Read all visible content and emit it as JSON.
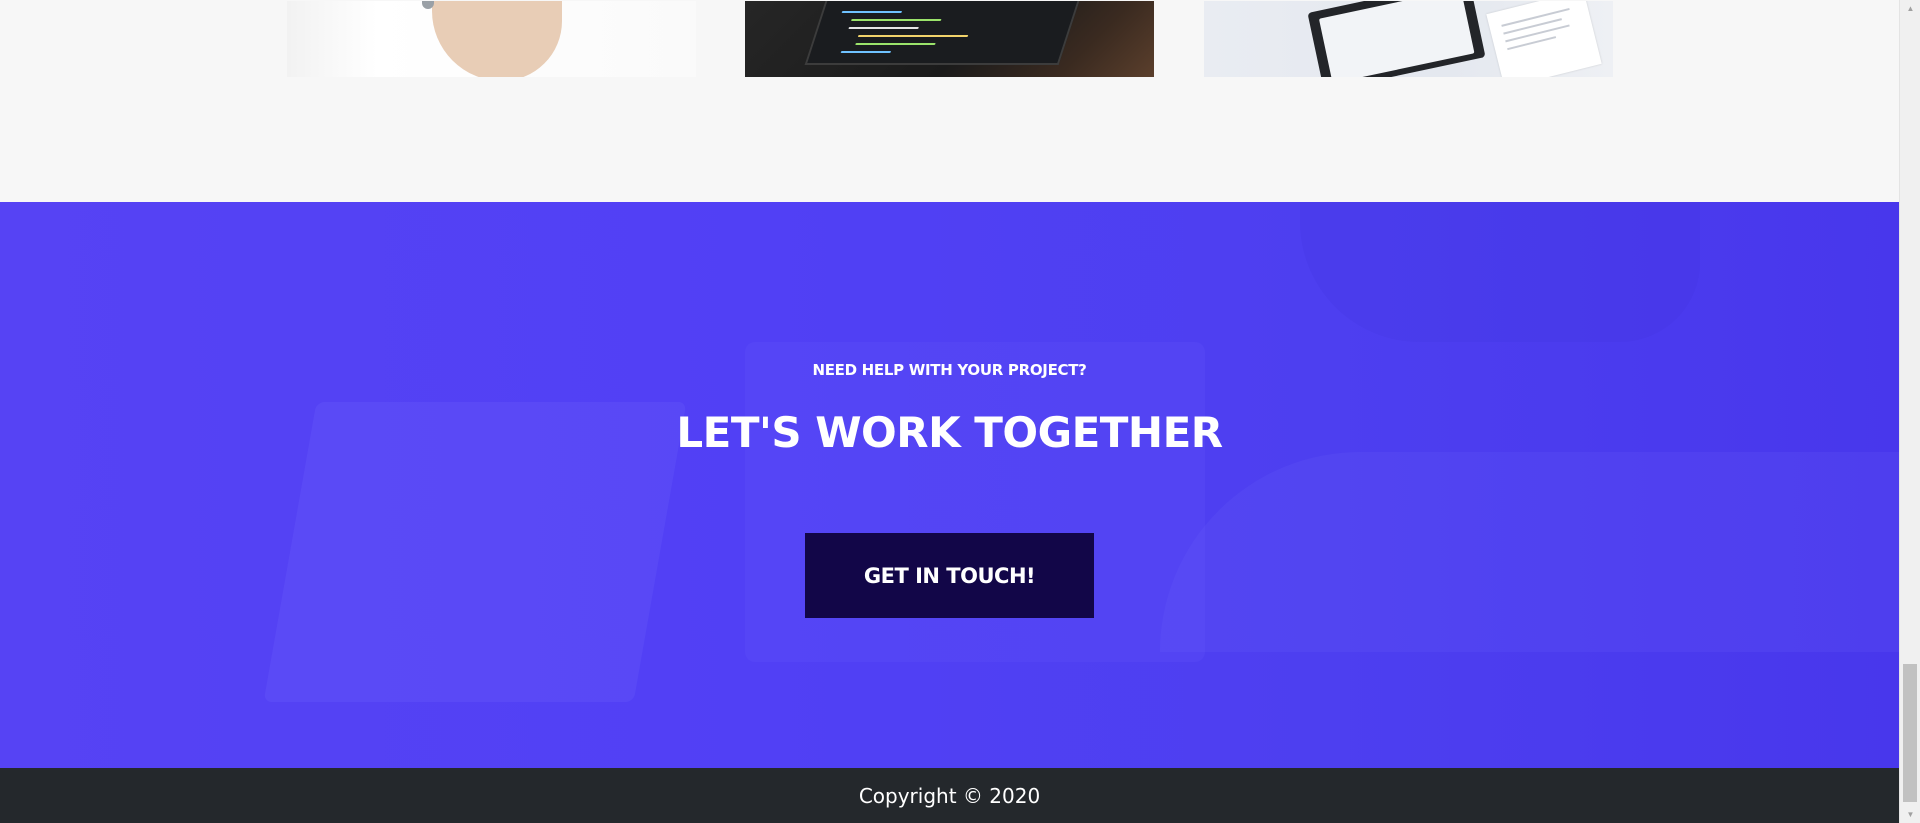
{
  "portfolio": {
    "thumbnails": [
      {
        "name": "thumbnail-hand-on-desk"
      },
      {
        "name": "thumbnail-laptop-code"
      },
      {
        "name": "thumbnail-tablet-app"
      }
    ]
  },
  "cta": {
    "eyebrow": "NEED HELP WITH YOUR PROJECT?",
    "title": "LET'S WORK TOGETHER",
    "button_label": "GET IN TOUCH!",
    "background_color": "#5241f4",
    "button_color": "#120648"
  },
  "footer": {
    "copyright": "Copyright © 2020",
    "background_color": "#24282c"
  },
  "scrollbar": {
    "up_icon": "scroll-up-arrow-icon",
    "down_icon": "scroll-down-arrow-icon"
  }
}
